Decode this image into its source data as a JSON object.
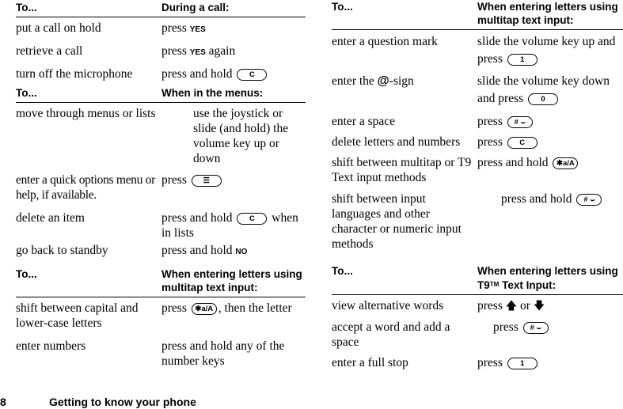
{
  "keys": {
    "c": "C",
    "one": "1",
    "zero": "0",
    "menu": "☰",
    "star": "✱a/A",
    "hash": "# ⌣"
  },
  "left": {
    "call": {
      "header_a": "To...",
      "header_b": "During a call:",
      "rows": [
        {
          "a": "put a call on hold",
          "b1": "press ",
          "sc": "YES",
          "b2": ""
        },
        {
          "a": "retrieve a call",
          "b1": "press ",
          "sc": "YES",
          "b2": " again"
        },
        {
          "a": "turn off the microphone",
          "b1": "press and hold "
        }
      ]
    },
    "menus": {
      "header_a": "To...",
      "header_b": "When in the menus:",
      "rows": [
        {
          "a": "move through menus or lists",
          "b": "use the joystick or slide (and hold) the volume key up or down"
        },
        {
          "a": "enter a quick options menu or help, if available.",
          "b1": "press "
        },
        {
          "a": "delete an item",
          "b1": "press and hold ",
          "b2": " when in lists"
        },
        {
          "a": "go back to standby",
          "b1": "press and hold ",
          "sc": "NO"
        }
      ]
    },
    "multitap": {
      "header_a": "To...",
      "header_b": "When entering letters using multitap text input:",
      "rows": [
        {
          "a": "shift between capital and lower-case letters",
          "b1": "press ",
          "b2": ", then the letter"
        },
        {
          "a": "enter numbers",
          "b": "press and hold any of the number keys"
        }
      ]
    }
  },
  "right": {
    "multitap": {
      "header_a": "To...",
      "header_b": "When entering letters using multitap text input:",
      "rows": [
        {
          "a": "enter a question mark",
          "b1": "slide the volume key up and press "
        },
        {
          "a1": "enter the ",
          "at": "@",
          "a2": "-sign",
          "b1": "slide the volume key down and press "
        },
        {
          "a": "enter a space",
          "b1": "press "
        },
        {
          "a": "delete letters and numbers",
          "b1": "press "
        },
        {
          "a": "shift between multitap or T9 Text input methods",
          "b1": "press and hold "
        },
        {
          "a": "shift between input languages and other character or numeric input methods",
          "b1": "press and hold "
        }
      ]
    },
    "t9": {
      "header_a": "To...",
      "header_b1": "When entering letters using T9",
      "tm": "TM",
      "header_b2": " Text Input:",
      "rows": [
        {
          "a": "view alternative words",
          "b1": "press ",
          "up": "🡅",
          "or": " or ",
          "down": "🡇"
        },
        {
          "a": "accept a word and add a space",
          "b1": "press "
        },
        {
          "a": "enter a full stop",
          "b1": "press "
        }
      ]
    }
  },
  "footer": {
    "page_number": "8",
    "title": "Getting to know your phone"
  }
}
